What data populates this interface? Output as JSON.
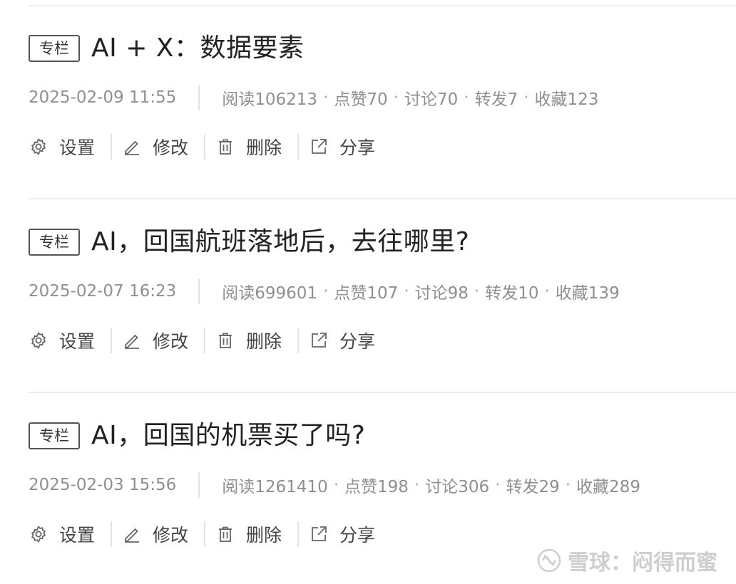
{
  "articles": [
    {
      "tag": "专栏",
      "title": "AI + X：数据要素",
      "date": "2025-02-09 11:55",
      "stats": [
        "阅读106213",
        "点赞70",
        "讨论70",
        "转发7",
        "收藏123"
      ],
      "actions": [
        "设置",
        "修改",
        "删除",
        "分享"
      ]
    },
    {
      "tag": "专栏",
      "title": "AI，回国航班落地后，去往哪里?",
      "date": "2025-02-07 16:23",
      "stats": [
        "阅读699601",
        "点赞107",
        "讨论98",
        "转发10",
        "收藏139"
      ],
      "actions": [
        "设置",
        "修改",
        "删除",
        "分享"
      ]
    },
    {
      "tag": "专栏",
      "title": "AI，回国的机票买了吗?",
      "date": "2025-02-03 15:56",
      "stats": [
        "阅读1261410",
        "点赞198",
        "讨论306",
        "转发29",
        "收藏289"
      ],
      "actions": [
        "设置",
        "修改",
        "删除",
        "分享"
      ]
    }
  ],
  "stat_separator": "·",
  "icons": [
    "gear-icon",
    "pencil-icon",
    "trash-icon",
    "share-icon"
  ],
  "watermark": {
    "text": "雪球：闷得而蜜"
  },
  "colors": {
    "meta_text": "#8f8f8f",
    "divider": "#ececec",
    "tag_border": "#555555"
  }
}
